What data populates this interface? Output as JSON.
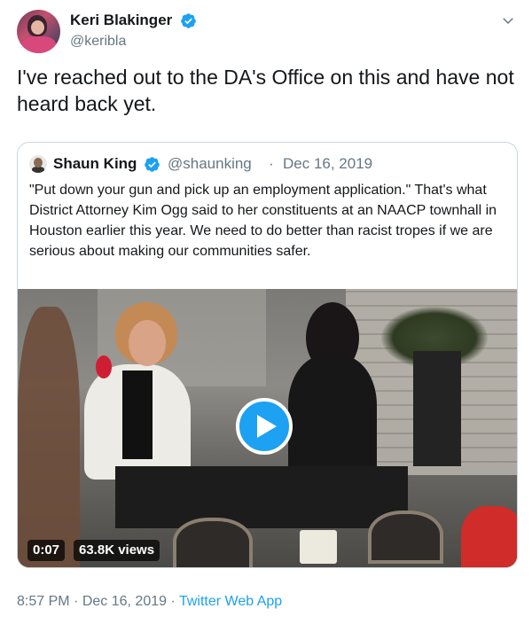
{
  "author": {
    "name": "Keri Blakinger",
    "handle": "@keribla"
  },
  "tweet": {
    "text": "I've reached out to the DA's Office on this and have not heard back yet."
  },
  "quoted_tweet": {
    "name": "Shaun King",
    "handle": "@shaunking",
    "separator": "·",
    "date": "Dec 16, 2019",
    "text": "\"Put down your gun and pick up an employment application.\" That's what District Attorney Kim Ogg said to her constituents at an NAACP townhall in Houston earlier this year. We need to do better than racist tropes if we are serious about making our communities safer.",
    "video": {
      "duration": "0:07",
      "views": "63.8K views"
    }
  },
  "meta": {
    "time": "8:57 PM",
    "separator1": "·",
    "date": "Dec 16, 2019",
    "separator2": "·",
    "source": "Twitter Web App"
  },
  "icons": {
    "verified": "verified-badge-icon",
    "caret": "chevron-down-icon",
    "play": "play-icon"
  },
  "colors": {
    "accent": "#1da1f2",
    "secondary_text": "#657786",
    "border": "#ccd6dd"
  }
}
